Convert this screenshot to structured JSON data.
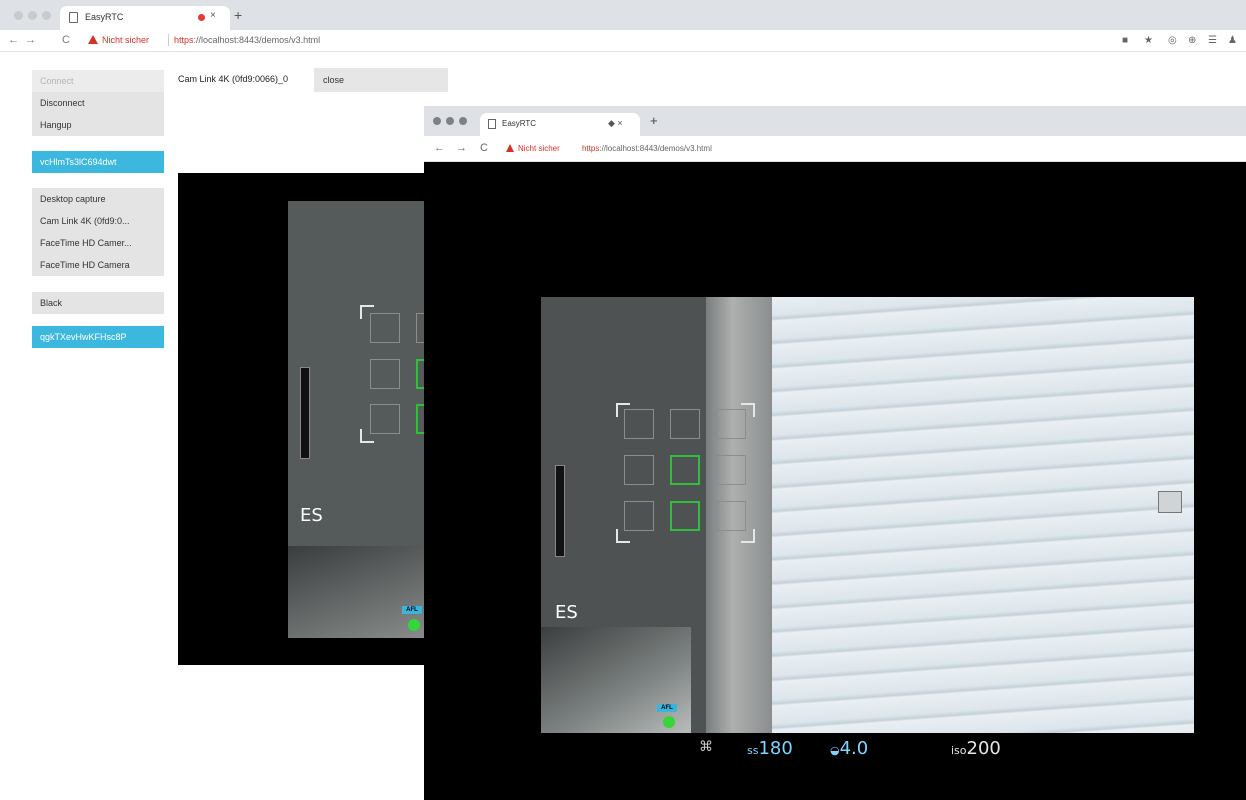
{
  "browser": {
    "tab_title": "EasyRTC",
    "new_tab_label": "+",
    "close_tab": "×",
    "back": "←",
    "forward": "→",
    "reload": "C",
    "security_label": "Nicht sicher",
    "url_scheme": "https",
    "url_rest": "://localhost:8443/demos/v3.html"
  },
  "panel": {
    "connect": "Connect",
    "disconnect": "Disconnect",
    "hangup": "Hangup",
    "self_id": "vcHlmTs3lC694dwt",
    "sources": [
      "Desktop capture",
      "Cam Link 4K (0fd9:0...",
      "FaceTime HD Camer...",
      "FaceTime HD Camera"
    ],
    "black": "Black",
    "peer_id": "qgkTXevHwKFHsc8P"
  },
  "stream": {
    "camera_label": "Cam Link 4K (0fd9:0066)_0",
    "close_label": "close"
  },
  "window2": {
    "tab_title": "EasyRTC",
    "tab_controls": "◆ ×",
    "new_tab_label": "+",
    "security_label": "Nicht sicher",
    "url_scheme": "https",
    "url_rest": "://localhost:8443/demos/v3.html"
  },
  "viewfinder": {
    "mode": "ES",
    "afl": "AFL",
    "shutter_prefix": "ss",
    "shutter": "180",
    "aperture": "4.0",
    "iso_prefix": "iso",
    "iso": "200"
  }
}
